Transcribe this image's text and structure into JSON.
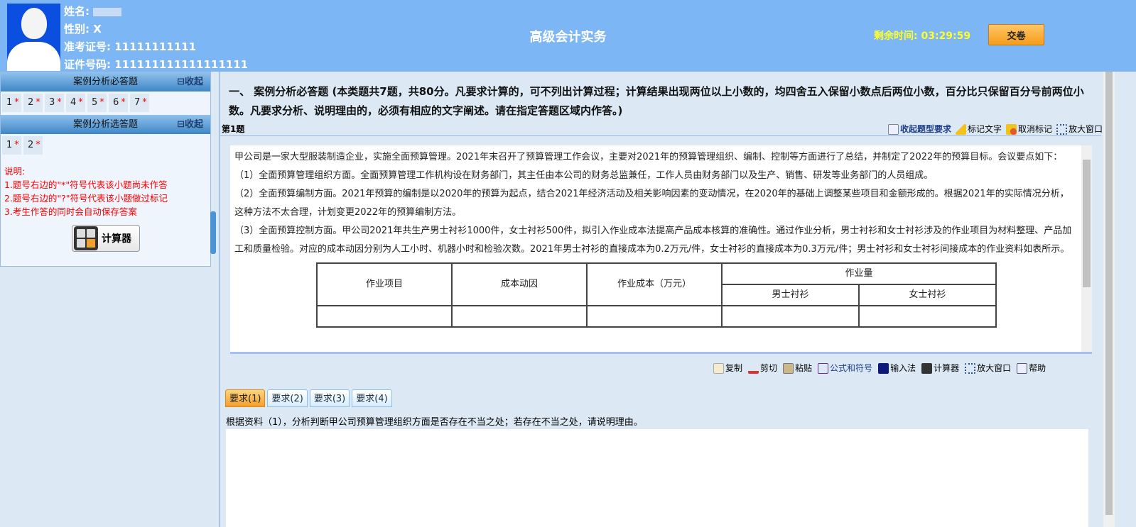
{
  "header": {
    "name_label": "姓名:",
    "gender_label": "性别:",
    "gender": "X",
    "exam_id_label": "准考证号:",
    "exam_id": "11111111111",
    "id_label": "证件号码:",
    "id_number": "111111111111111111",
    "title": "高级会计实务",
    "timer_label": "剩余时间:",
    "timer": "03:29:59",
    "submit": "交卷"
  },
  "sidebar": {
    "sections": [
      {
        "title": "案例分析必答题",
        "collapse": "⊟收起",
        "questions": [
          "1",
          "2",
          "3",
          "4",
          "5",
          "6",
          "7"
        ]
      },
      {
        "title": "案例分析选答题",
        "collapse": "⊟收起",
        "questions": [
          "1",
          "2"
        ]
      }
    ],
    "mark": "*",
    "notes": [
      "说明:",
      "1.题号右边的\"*\"符号代表该小题尚未作答",
      "2.题号右边的\"?\"符号代表该小题做过标记",
      "3.考生作答的同时会自动保存答案"
    ],
    "calculator": "计算器"
  },
  "main": {
    "heading": "一、 案例分析必答题 (本类题共7题，共80分。凡要求计算的，可不列出计算过程；计算结果出现两位以上小数的，均四舍五入保留小数点后两位小数，百分比只保留百分号前两位小数。凡要求分析、说明理由的，必须有相应的文字阐述。请在指定答题区域内作答。)",
    "question_no": "第1题",
    "tools": [
      "收起题型要求",
      "标记文字",
      "取消标记",
      "放大窗口"
    ],
    "paragraphs": [
      "甲公司是一家大型服装制造企业，实施全面预算管理。2021年末召开了预算管理工作会议，主要对2021年的预算管理组织、编制、控制等方面进行了总结，并制定了2022年的预算目标。会议要点如下：",
      "（1）全面预算管理组织方面。全面预算管理工作机构设在财务部门，其主任由本公司的财务总监兼任，工作人员由财务部门以及生产、销售、研发等业务部门的人员组成。",
      "（2）全面预算编制方面。2021年预算的编制是以2020年的预算为起点，结合2021年经济活动及相关影响因素的变动情况，在2020年的基础上调整某些项目和金额形成的。根据2021年的实际情况分析，这种方法不太合理，计划变更2022年的预算编制方法。",
      "（3）全面预算控制方面。甲公司2021年共生产男士衬衫1000件，女士衬衫500件，拟引入作业成本法提高产品成本核算的准确性。通过作业分析，男士衬衫和女士衬衫涉及的作业项目为材料整理、产品加工和质量检验。对应的成本动因分别为人工小时、机器小时和检验次数。2021年男士衬衫的直接成本为0.2万元/件，女士衬衫的直接成本为0.3万元/件；男士衬衫和女士衬衫间接成本的作业资料如表所示。"
    ],
    "table": {
      "h1": "作业项目",
      "h2": "成本动因",
      "h3": "作业成本（万元）",
      "h4": "作业量",
      "h5": "男士衬衫",
      "h6": "女士衬衫"
    },
    "editor_tools": [
      "复制",
      "剪切",
      "粘贴",
      "公式和符号",
      "输入法",
      "计算器",
      "放大窗口",
      "帮助"
    ],
    "tabs": [
      "要求(1)",
      "要求(2)",
      "要求(3)",
      "要求(4)"
    ],
    "prompt": "根据资料（1），分析判断甲公司预算管理组织方面是否存在不当之处；若存在不当之处，请说明理由。"
  }
}
